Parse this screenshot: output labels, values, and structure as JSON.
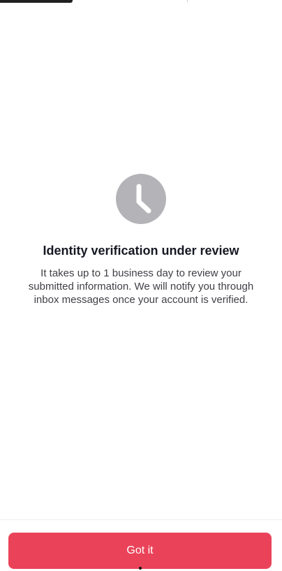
{
  "status": {
    "title": "Identity verification under review",
    "message": "It takes up to 1 business day to review your submitted information. We will notify you through inbox messages once your account is verified.",
    "icon": "clock-icon",
    "icon_color": "#b4b4b8"
  },
  "actions": {
    "primary_label": "Got it",
    "primary_color": "#ea4359"
  }
}
